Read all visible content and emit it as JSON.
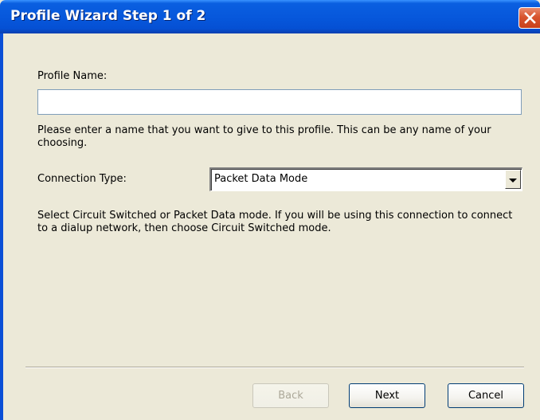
{
  "window": {
    "title": "Profile Wizard Step 1 of 2",
    "close_icon": "close-icon"
  },
  "form": {
    "profile_name_label": "Profile Name:",
    "profile_name_value": "",
    "profile_name_help": "Please enter a name that you want to give to this profile. This can be any name of your choosing.",
    "connection_type_label": "Connection Type:",
    "connection_type_value": "Packet Data Mode",
    "connection_type_help": "Select Circuit Switched or Packet Data mode.  If you will be using this connection to connect to a dialup network, then choose Circuit Switched mode."
  },
  "buttons": {
    "back_label": "Back",
    "back_enabled": false,
    "next_label": "Next",
    "cancel_label": "Cancel"
  },
  "colors": {
    "titlebar": "#0758DC",
    "dialog_bg": "#ECE9D8",
    "close_button": "#D8542E"
  }
}
